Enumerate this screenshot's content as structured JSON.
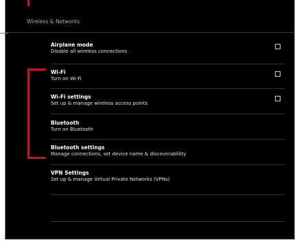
{
  "header": {
    "title": "Wireless & Networks"
  },
  "items": [
    {
      "title": "Airplane mode",
      "subtitle": "Disable all wireless connections",
      "checkbox": true,
      "checked": false
    },
    {
      "title": "Wi-Fi",
      "subtitle": "Turn on Wi-Fi",
      "checkbox": true,
      "checked": false
    },
    {
      "title": "Wi-Fi settings",
      "subtitle": "Set up & manage wireless access points",
      "checkbox": true,
      "checked": false
    },
    {
      "title": "Bluetooth",
      "subtitle": "Turn on Bluetooth",
      "checkbox": false
    },
    {
      "title": "Bluetooth settings",
      "subtitle": "Manage connections, set device name & discoverablility",
      "checkbox": false
    },
    {
      "title": "VPN Settings",
      "subtitle": "Set up & manage Virtual Private Networks (VPNs)",
      "checkbox": false
    }
  ],
  "colors": {
    "background": "#000000",
    "text": "#ffffff",
    "callout": "#c8102e"
  },
  "icons": [
    "checkbox-icon"
  ]
}
